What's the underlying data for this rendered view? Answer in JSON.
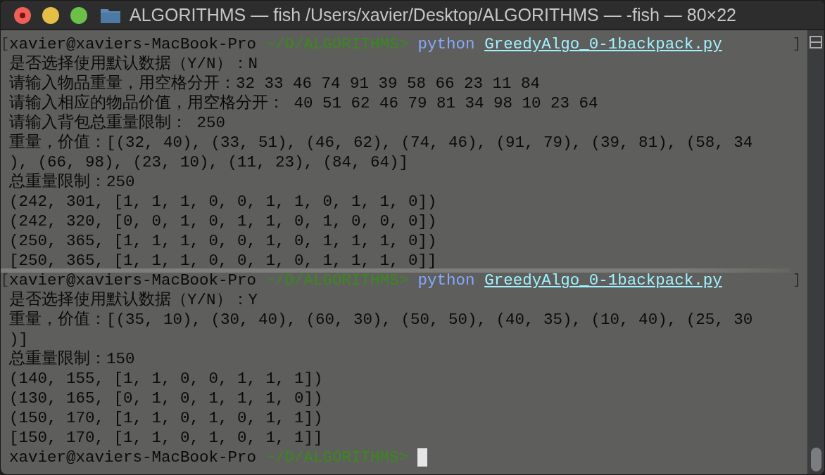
{
  "window": {
    "title": "ALGORITHMS — fish /Users/xavier/Desktop/ALGORITHMS — -fish — 80×22"
  },
  "lines": [
    {
      "kind": "prompt",
      "mark_open": "[",
      "user": "xavier@xaviers-MacBook-Pro",
      "path": "~/D/ALGORITHMS>",
      "command": "python",
      "argument": "GreedyAlgo_0-1backpack.py",
      "mark_close": "]",
      "divider_above": false,
      "cursor": false
    },
    {
      "kind": "output",
      "text": "是否选择使用默认数据（Y/N）：N"
    },
    {
      "kind": "output",
      "text": "请输入物品重量，用空格分开：32 33 46 74 91 39 58 66 23 11 84"
    },
    {
      "kind": "output",
      "text": "请输入相应的物品价值，用空格分开： 40 51 62 46 79 81 34 98 10 23 64"
    },
    {
      "kind": "output",
      "text": "请输入背包总重量限制： 250"
    },
    {
      "kind": "output",
      "text": "重量，价值：[(32, 40), (33, 51), (46, 62), (74, 46), (91, 79), (39, 81), (58, 34"
    },
    {
      "kind": "output",
      "text": "), (66, 98), (23, 10), (11, 23), (84, 64)]"
    },
    {
      "kind": "output",
      "text": "总重量限制：250"
    },
    {
      "kind": "output",
      "text": "(242, 301, [1, 1, 1, 0, 0, 1, 1, 0, 1, 1, 0])"
    },
    {
      "kind": "output",
      "text": "(242, 320, [0, 0, 1, 0, 1, 1, 0, 1, 0, 0, 0])"
    },
    {
      "kind": "output",
      "text": "(250, 365, [1, 1, 1, 0, 0, 1, 0, 1, 1, 1, 0])"
    },
    {
      "kind": "output",
      "text": "[250, 365, [1, 1, 1, 0, 0, 1, 0, 1, 1, 1, 0]]"
    },
    {
      "kind": "prompt",
      "mark_open": "[",
      "user": "xavier@xaviers-MacBook-Pro",
      "path": "~/D/ALGORITHMS>",
      "command": "python",
      "argument": "GreedyAlgo_0-1backpack.py",
      "mark_close": "]",
      "divider_above": true,
      "cursor": false
    },
    {
      "kind": "output",
      "text": "是否选择使用默认数据（Y/N）：Y"
    },
    {
      "kind": "output",
      "text": "重量，价值：[(35, 10), (30, 40), (60, 30), (50, 50), (40, 35), (10, 40), (25, 30"
    },
    {
      "kind": "output",
      "text": ")]"
    },
    {
      "kind": "output",
      "text": "总重量限制：150"
    },
    {
      "kind": "output",
      "text": "(140, 155, [1, 1, 0, 0, 1, 1, 1])"
    },
    {
      "kind": "output",
      "text": "(130, 165, [0, 1, 0, 1, 1, 1, 0])"
    },
    {
      "kind": "output",
      "text": "(150, 170, [1, 1, 0, 1, 0, 1, 1])"
    },
    {
      "kind": "output",
      "text": "[150, 170, [1, 1, 0, 1, 0, 1, 1]]"
    },
    {
      "kind": "prompt",
      "user": "xavier@xaviers-MacBook-Pro",
      "path": "~/D/ALGORITHMS>",
      "divider_above": false,
      "cursor": true
    }
  ]
}
